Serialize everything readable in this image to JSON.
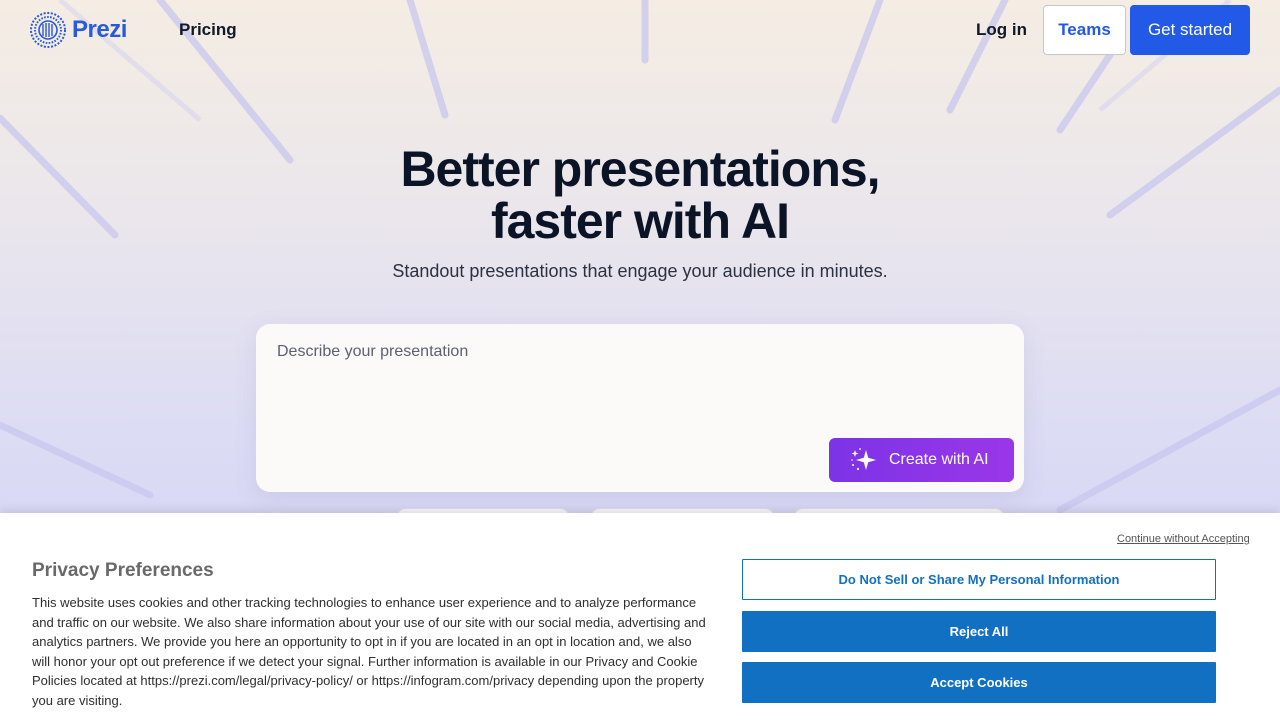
{
  "header": {
    "logo_text": "Prezi",
    "nav_pricing": "Pricing",
    "login": "Log in",
    "teams": "Teams",
    "get_started": "Get started"
  },
  "hero": {
    "title_line1": "Better presentations,",
    "title_line2": "faster with AI",
    "subtitle": "Standout presentations that engage your audience in minutes."
  },
  "prompt": {
    "placeholder": "Describe your presentation",
    "create_button": "Create with AI"
  },
  "cookie_banner": {
    "title": "Privacy Preferences",
    "text": "This website uses cookies and other tracking technologies to enhance user experience and to analyze performance and traffic on our website. We also share information about your use of our site with our social media, advertising and analytics partners. We provide you here an opportunity to opt in if you are located in an opt in location and, we also will honor your opt out preference if we detect your signal. Further information is available in our Privacy and Cookie Policies located at https://prezi.com/legal/privacy-policy/ or https://infogram.com/privacy depending upon the property you are visiting.",
    "continue_without": "Continue without Accepting",
    "do_not_sell": "Do Not Sell or Share My Personal Information",
    "reject_all": "Reject All",
    "accept": "Accept Cookies"
  },
  "colors": {
    "brand_blue": "#2259e6",
    "ai_purple": "#8a35e7",
    "cookie_blue": "#1270c2"
  },
  "icons": {
    "logo": "prezi-logo-icon",
    "create": "sparkle-icon"
  }
}
